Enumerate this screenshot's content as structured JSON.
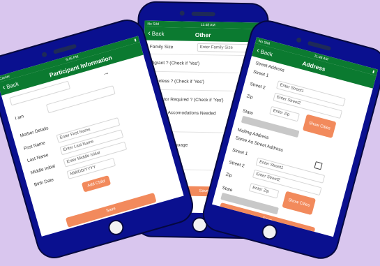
{
  "phone_left": {
    "status": {
      "carrier": "Carrier",
      "time": "9:45 PM"
    },
    "nav": {
      "back": "Back",
      "title": "Participant Information"
    },
    "fields": {
      "i_am": "I am",
      "mother_details": "Mother Details",
      "first_name": {
        "label": "First Name",
        "placeholder": "Enter First Name"
      },
      "last_name": {
        "label": "Last Name",
        "placeholder": "Enter Last Name"
      },
      "middle_initial": {
        "label": "Middle Initial",
        "placeholder": "Enter Middle Initial"
      },
      "birth_date": {
        "label": "Birth Date",
        "placeholder": "MM/DD/YYYY"
      }
    },
    "add_child": "Add Child",
    "save": "Save"
  },
  "phone_middle": {
    "status": {
      "carrier": "No SIM",
      "time": "11:48 AM"
    },
    "nav": {
      "back": "Back",
      "title": "Other"
    },
    "family_size": {
      "label": "Family Size",
      "placeholder": "Enter Family Size"
    },
    "migrant": "Migrant ? (Check if 'Yes')",
    "homeless": "Homeless ? (Check if 'Yes')",
    "translator": "Translator Required ? (Check if 'Yes')",
    "disability": "Disability Accomodations Needed",
    "language": "Language",
    "save": "Save"
  },
  "phone_right": {
    "status": {
      "carrier": "No SIM",
      "time": "11:48 AM"
    },
    "nav": {
      "back": "Back",
      "title": "Address"
    },
    "street_address": "Street Address",
    "street1": {
      "label": "Street 1",
      "placeholder": "Enter Street1"
    },
    "street2": {
      "label": "Street 2",
      "placeholder": "Enter Street2"
    },
    "zip": {
      "label": "Zip",
      "placeholder": "Enter Zip"
    },
    "state": "State",
    "show_cities": "Show Cities",
    "mailing_address": "Mailing Address",
    "same_as_street": "Same As Street Address",
    "mailing_street1": {
      "label": "Street 1",
      "placeholder": "Enter Street1"
    },
    "mailing_street2": {
      "label": "Street 2",
      "placeholder": "Enter Street2"
    },
    "mailing_zip": {
      "label": "Zip",
      "placeholder": "Enter Zip"
    },
    "mailing_state": "State",
    "mailing_show_cities": "Show Cities",
    "save": "Save"
  }
}
